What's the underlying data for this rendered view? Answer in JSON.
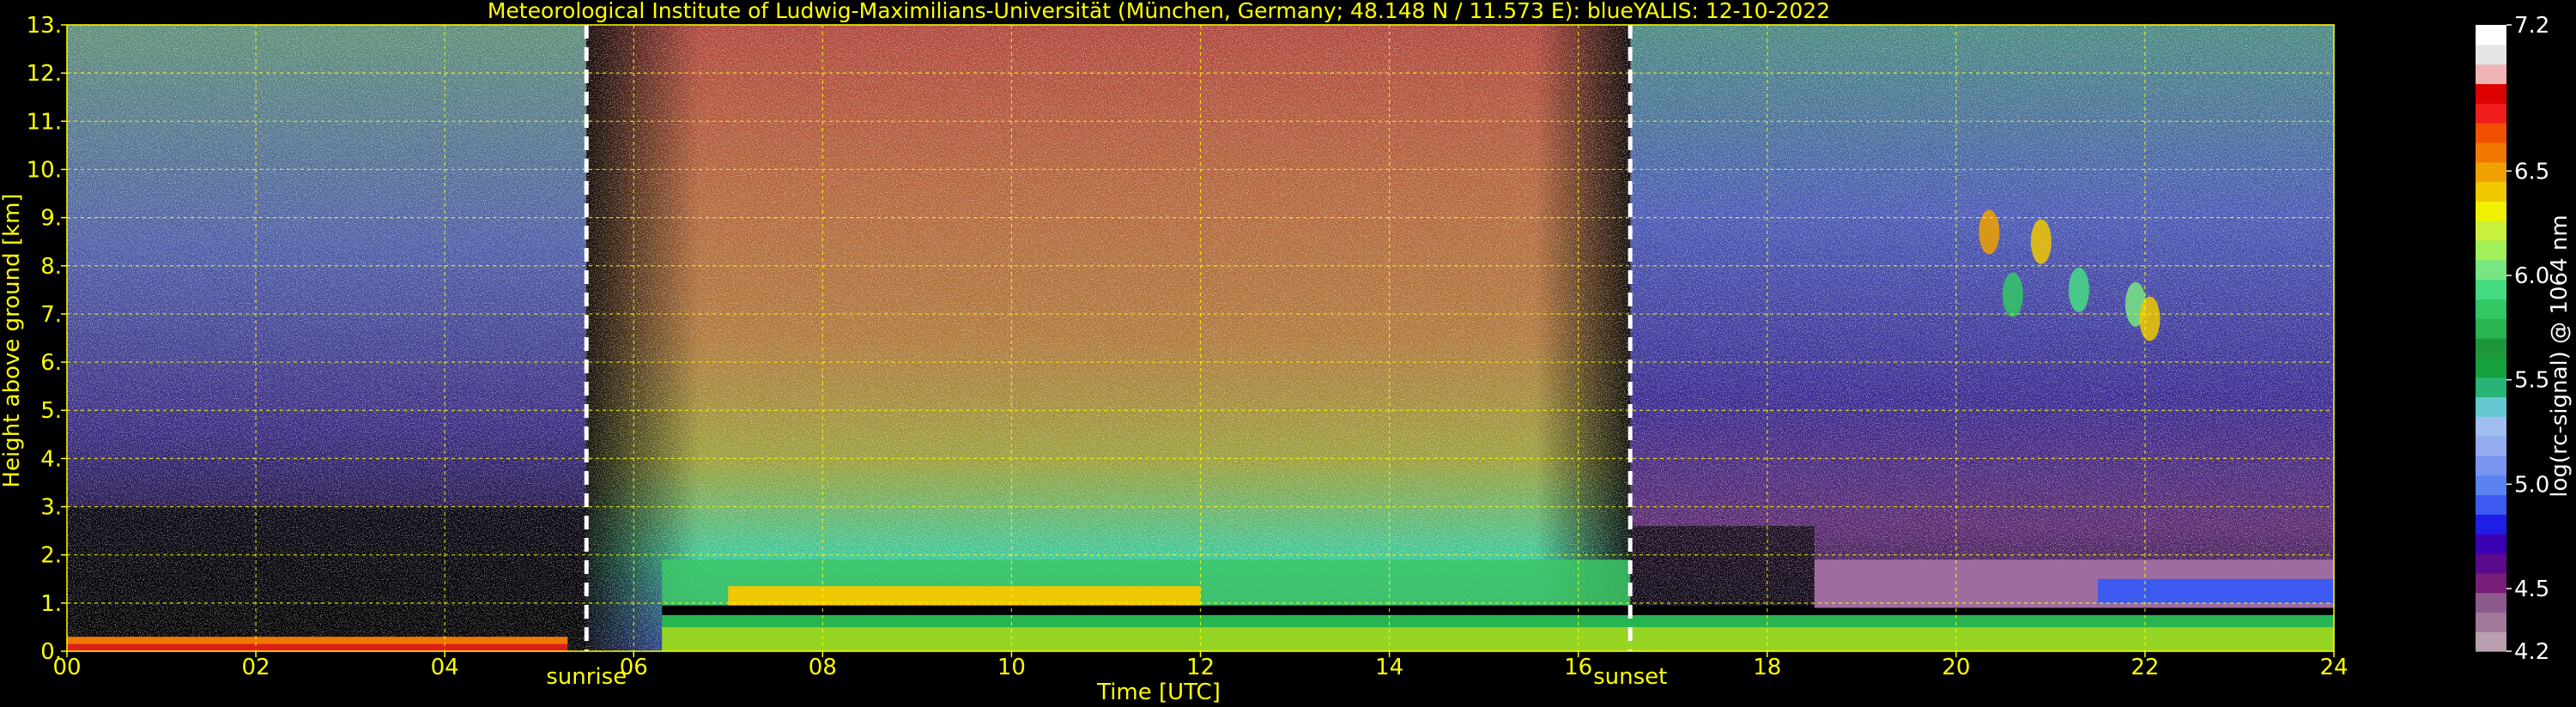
{
  "chart_data": {
    "type": "heatmap",
    "title": "Meteorological Institute of Ludwig-Maximilians-Universität (München, Germany; 48.148 N / 11.573 E):     blueYALIS: 12-10-2022",
    "xlabel": "Time [UTC]",
    "ylabel": "Height above ground [km]",
    "xlim": [
      0,
      24
    ],
    "ylim": [
      0,
      13
    ],
    "x_ticks": [
      {
        "value": 0,
        "label": "00"
      },
      {
        "value": 2,
        "label": "02"
      },
      {
        "value": 4,
        "label": "04"
      },
      {
        "value": 6,
        "label": "06"
      },
      {
        "value": 8,
        "label": "08"
      },
      {
        "value": 10,
        "label": "10"
      },
      {
        "value": 12,
        "label": "12"
      },
      {
        "value": 14,
        "label": "14"
      },
      {
        "value": 16,
        "label": "16"
      },
      {
        "value": 18,
        "label": "18"
      },
      {
        "value": 20,
        "label": "20"
      },
      {
        "value": 22,
        "label": "22"
      },
      {
        "value": 24,
        "label": "24"
      }
    ],
    "y_ticks": [
      {
        "value": 0,
        "label": "0."
      },
      {
        "value": 1,
        "label": "1."
      },
      {
        "value": 2,
        "label": "2."
      },
      {
        "value": 3,
        "label": "3."
      },
      {
        "value": 4,
        "label": "4."
      },
      {
        "value": 5,
        "label": "5."
      },
      {
        "value": 6,
        "label": "6."
      },
      {
        "value": 7,
        "label": "7."
      },
      {
        "value": 8,
        "label": "8."
      },
      {
        "value": 9,
        "label": "9."
      },
      {
        "value": 10,
        "label": "10."
      },
      {
        "value": 11,
        "label": "11."
      },
      {
        "value": 12,
        "label": "12."
      },
      {
        "value": 13,
        "label": "13."
      }
    ],
    "grid": true,
    "annotations": [
      {
        "name": "sunrise",
        "label": "sunrise",
        "x": 5.5
      },
      {
        "name": "sunset",
        "label": "sunset",
        "x": 16.55
      }
    ],
    "colorbar": {
      "label": "log(rc-signal) @ 1064 nm",
      "range": [
        4.2,
        7.2
      ],
      "ticks": [
        {
          "value": 4.2,
          "label": "4.2"
        },
        {
          "value": 4.5,
          "label": "4.5"
        },
        {
          "value": 5.0,
          "label": "5.0"
        },
        {
          "value": 5.5,
          "label": "5.5"
        },
        {
          "value": 6.0,
          "label": "6.0"
        },
        {
          "value": 6.5,
          "label": "6.5"
        },
        {
          "value": 7.2,
          "label": "7.2"
        }
      ],
      "colors": [
        "#b8a0b0",
        "#a07898",
        "#8c5a8c",
        "#781e78",
        "#5a0a8c",
        "#3c00b4",
        "#1e1ee6",
        "#3c5af0",
        "#5a82f0",
        "#7896f0",
        "#96aaf0",
        "#a0bef0",
        "#64c8d2",
        "#28b478",
        "#14a03c",
        "#1e963c",
        "#28b450",
        "#32c864",
        "#46dc82",
        "#78e682",
        "#a0f05a",
        "#c8f03c",
        "#f0f000",
        "#f0c800",
        "#f0a000",
        "#f07800",
        "#f05000",
        "#f01e1e",
        "#dc0000",
        "#f0b4b4",
        "#e6e6e6",
        "#ffffff"
      ]
    },
    "features": [
      {
        "name": "residual-layer-night",
        "x": [
          0,
          5.3
        ],
        "top_km": 0.3
      },
      {
        "name": "boundary-layer",
        "x": [
          6.3,
          24
        ],
        "top_km": [
          0.9,
          1.3
        ]
      },
      {
        "name": "pink-layer",
        "x": [
          18.5,
          24
        ],
        "range_km": [
          0.9,
          1.9
        ]
      },
      {
        "name": "cirrus-cloud",
        "x": [
          20.3,
          22.2
        ],
        "range_km": [
          6.8,
          8.9
        ]
      }
    ]
  }
}
